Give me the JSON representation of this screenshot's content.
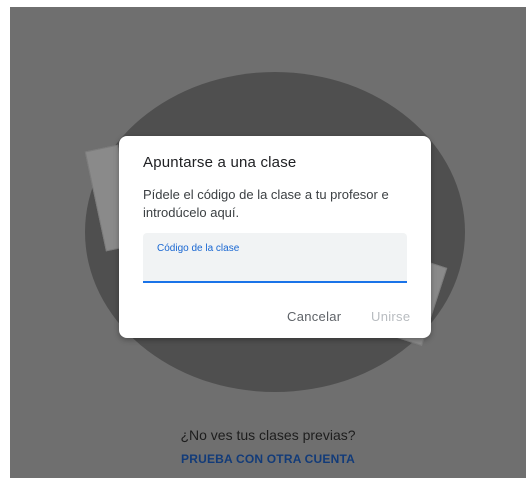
{
  "dialog": {
    "title": "Apuntarse a una clase",
    "description": "Pídele el código de la clase a tu profesor e introdúcelo aquí.",
    "field": {
      "label": "Código de la clase",
      "value": ""
    },
    "buttons": {
      "cancel": "Cancelar",
      "join": "Unirse"
    }
  },
  "background": {
    "question": "¿No ves tus clases previas?",
    "link": "PRUEBA CON OTRA CUENTA"
  },
  "colors": {
    "overlay": "#6f6f6f",
    "accent": "#1a73e8",
    "link": "#123b79",
    "disabled": "#b8bcc0"
  }
}
